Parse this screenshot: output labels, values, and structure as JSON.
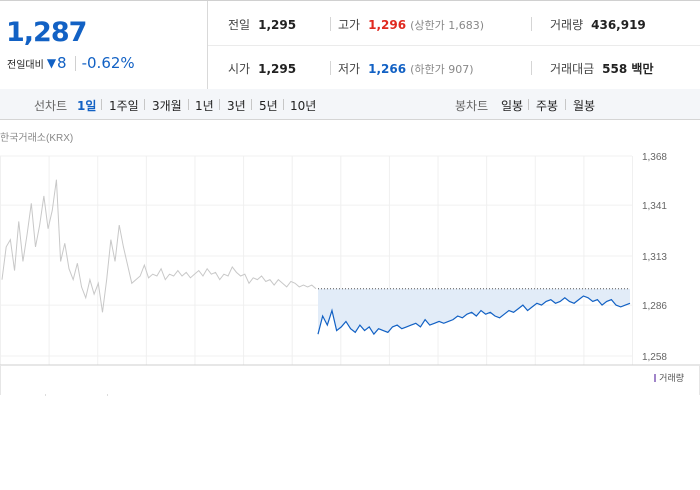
{
  "summary": {
    "price": "1,287",
    "change_label": "전일대비",
    "change_arrow": "▼",
    "change_amount": "8",
    "change_pct": "-0.62%",
    "prev_close_label": "전일",
    "prev_close": "1,295",
    "high_label": "고가",
    "high": "1,296",
    "upper_limit": "(상한가 1,683)",
    "volume_label": "거래량",
    "volume": "436,919",
    "open_label": "시가",
    "open": "1,295",
    "low_label": "저가",
    "low": "1,266",
    "lower_limit": "(하한가 907)",
    "trade_value_label": "거래대금",
    "trade_value": "558 백만"
  },
  "tabs": {
    "line_label": "선차트",
    "line_tabs": [
      "1일",
      "1주일",
      "3개월",
      "1년",
      "3년",
      "5년",
      "10년"
    ],
    "active_line_tab": "1일",
    "candle_label": "봉차트",
    "candle_tabs": [
      "일봉",
      "주봉",
      "월봉"
    ]
  },
  "chart": {
    "source": "한국거래소(KRX)",
    "legend": "거래량",
    "colors": {
      "up": "#e0291f",
      "down": "#1261c4",
      "prev_line": "#c8c8c8",
      "fill": "#e2ecf8"
    }
  },
  "chart_data": {
    "type": "line",
    "yticks": [
      1368,
      1341,
      1313,
      1286,
      1258
    ],
    "ylim": [
      1258,
      1368
    ],
    "prev_close": 1295,
    "series": [
      {
        "name": "",
        "values": [
          1300,
          1318,
          1322,
          1305,
          1332,
          1310,
          1325,
          1342,
          1318,
          1330,
          1346,
          1328,
          1338,
          1355,
          1310,
          1320,
          1306,
          1300,
          1309,
          1296,
          1290,
          1300,
          1292,
          1298,
          1282,
          1300,
          1322,
          1310,
          1330,
          1318,
          1308,
          1298,
          1300,
          1302,
          1308,
          1301,
          1303,
          1302,
          1306,
          1300,
          1303,
          1302,
          1305,
          1302,
          1304,
          1301,
          1303,
          1305,
          1302,
          1306,
          1303,
          1304,
          1300,
          1303,
          1302,
          1307,
          1304,
          1302,
          1303,
          1298,
          1301,
          1300,
          1302,
          1299,
          1300,
          1297,
          1300,
          1298,
          1296,
          1299,
          1298,
          1296,
          1297,
          1296,
          1297,
          1295
        ]
      },
      {
        "name": "",
        "values": [
          1270,
          1280,
          1275,
          1283,
          1272,
          1274,
          1277,
          1273,
          1271,
          1275,
          1272,
          1274,
          1270,
          1273,
          1272,
          1271,
          1274,
          1275,
          1273,
          1274,
          1275,
          1276,
          1274,
          1278,
          1275,
          1276,
          1277,
          1276,
          1277,
          1278,
          1280,
          1279,
          1281,
          1282,
          1280,
          1283,
          1281,
          1282,
          1280,
          1279,
          1281,
          1283,
          1282,
          1284,
          1286,
          1283,
          1285,
          1287,
          1286,
          1288,
          1289,
          1287,
          1288,
          1290,
          1288,
          1287,
          1289,
          1291,
          1290,
          1288,
          1289,
          1286,
          1288,
          1289,
          1286,
          1285,
          1286,
          1287
        ]
      }
    ]
  }
}
